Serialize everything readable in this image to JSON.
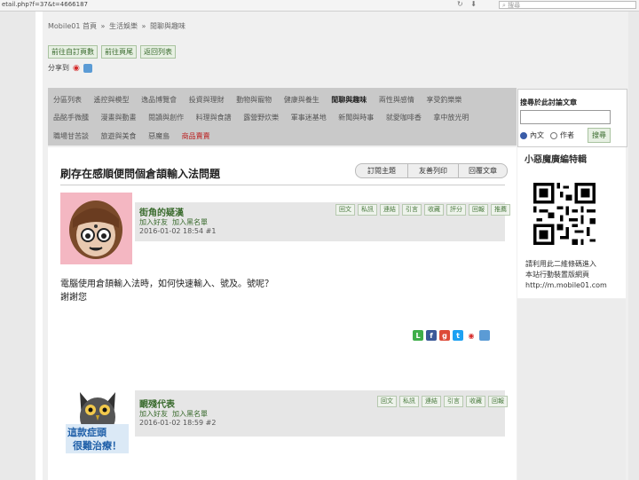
{
  "browser": {
    "url": "etail.php?f=37&t=4666187",
    "search_placeholder": "搜尋"
  },
  "breadcrumb": [
    "Mobile01 首頁",
    "»",
    "生活娛樂",
    "»",
    "閒聊與趣味"
  ],
  "top_buttons": [
    "前往自訂頁數",
    "前往頁尾",
    "返回列表"
  ],
  "share_label": "分享到",
  "categories": {
    "row1": [
      "分區列表",
      "遙控與模型",
      "逸品博覽會",
      "投資與理財",
      "動物與寵物",
      "健康與養生",
      "閒聊與趣味",
      "兩性與感情",
      "享受釣樂樂"
    ],
    "row2": [
      "品酩手微醺",
      "漫畫與動畫",
      "閱讀與創作",
      "料理與食譜",
      "露營野炊樂",
      "軍事迷基地",
      "新聞與時事",
      "就愛咖啡香",
      "拿中放光明"
    ],
    "row3": [
      "職場甘苦談",
      "旅遊與美食",
      "惡魔島",
      "商品賣賣"
    ]
  },
  "search": {
    "title": "搜尋於此討論文章",
    "option_content": "內文",
    "option_author": "作者",
    "button": "搜尋"
  },
  "sidebar": {
    "heading": "小惡魔廣編特輯",
    "line1": "請利用此二維條碼進入",
    "line2": "本站行動裝置版網頁",
    "line3": "http://m.mobile01.com"
  },
  "thread": {
    "title": "刷存在感順便問個倉頡輸入法問題",
    "tabs": [
      "訂閱主題",
      "友善列印",
      "回覆文章"
    ]
  },
  "posts": [
    {
      "username": "街角的疑漢",
      "add_friend": "加入好友",
      "add_blacklist": "加入黑名單",
      "datetime": "2016-01-02 18:54",
      "floor": "#1",
      "actions": [
        "回文",
        "私訊",
        "連結",
        "引言",
        "收藏",
        "評分",
        "回報",
        "推薦"
      ],
      "content_line1": "電腦使用倉頡輸入法時，如何快速輸入、號及。號呢？",
      "content_line2": "謝謝您"
    },
    {
      "username": "靦殘代表",
      "add_friend": "加入好友",
      "add_blacklist": "加入黑名單",
      "datetime": "2016-01-02 18:59",
      "floor": "#2",
      "actions": [
        "回文",
        "私訊",
        "連結",
        "引言",
        "收藏",
        "回報"
      ],
      "avatar_caption1": "這款症頭",
      "avatar_caption2": "很難治療！"
    }
  ],
  "colors": {
    "accent_green": "#3a6b2e",
    "category_bg": "#c9c9c9",
    "red_highlight": "#b22222"
  }
}
